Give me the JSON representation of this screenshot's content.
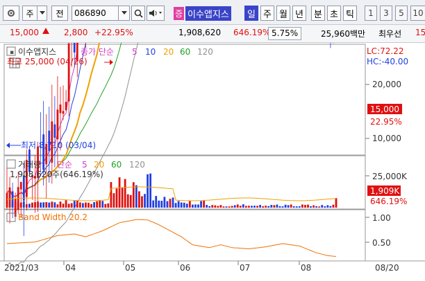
{
  "toolbar": {
    "code_type": "주",
    "view_mode": "전",
    "code": "086890",
    "tag": "증",
    "stock_name": "이수앱지스",
    "periods": [
      "일",
      "주",
      "월",
      "년",
      "분",
      "초",
      "틱"
    ],
    "selected_period": "일",
    "intervals": [
      "1",
      "3",
      "5",
      "10"
    ]
  },
  "quote": {
    "price": "15,000",
    "change": "2,800",
    "change_pct": "+22.95%",
    "volume": "1,908,620",
    "volume_pct": "646.19%",
    "turnover_pct": "5.75%",
    "amount": "25,960백만",
    "best_ask_label": "최우선",
    "best_ask_value": "15"
  },
  "price_panel": {
    "legend_name": "이수앱지스",
    "legend_ma": "종가 단순",
    "ma_periods": [
      "5",
      "10",
      "20",
      "60",
      "120"
    ],
    "high_label": "최고 25,000 (04/26)",
    "low_label": "최저 8,710 (03/04)",
    "lc": "LC:72.22",
    "hc": "HC:-40.00",
    "axis_ticks": [
      "20,000",
      "10,000"
    ],
    "current_price": "15,000",
    "current_pct": "22.95%"
  },
  "volume_panel": {
    "legend_name": "거래량",
    "legend_ma": "단순",
    "ma_periods": [
      "5",
      "20",
      "60",
      "120"
    ],
    "info": "1,908,620주(646.19%)",
    "axis_tick": "25,000K",
    "current_value": "1,909K",
    "current_pct": "646.19%"
  },
  "bw_panel": {
    "legend": "Band Width 20.2",
    "axis_ticks": [
      "1.00",
      "0.50"
    ]
  },
  "x_axis": {
    "labels": [
      "2021/03",
      "04",
      "05",
      "06",
      "07",
      "08",
      "08/20"
    ]
  },
  "colors": {
    "up": "#e01010",
    "down": "#2040e0",
    "ma5": "#d040c0",
    "ma10": "#2040e0",
    "ma20": "#f0a000",
    "ma60": "#20a020",
    "ma120": "#909090",
    "bw": "#f07000",
    "accent": "#3a44c8"
  }
}
